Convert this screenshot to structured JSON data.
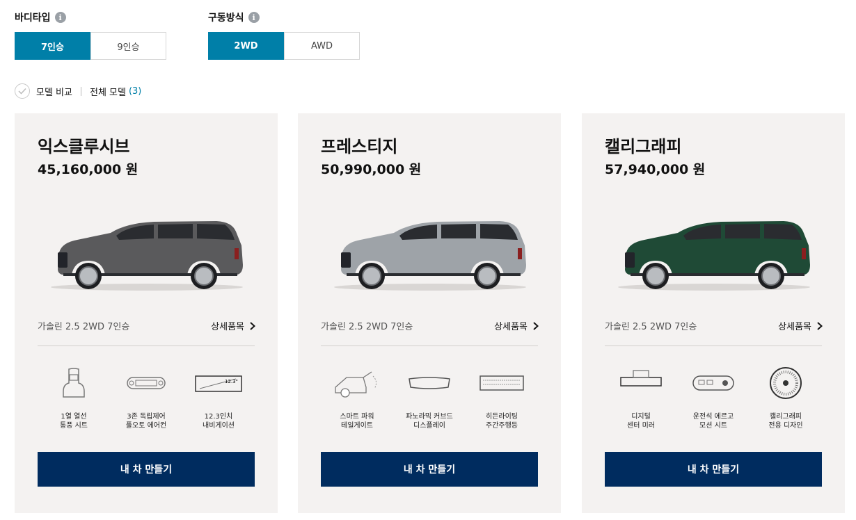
{
  "filters": {
    "body_type": {
      "label": "바디타입",
      "options": [
        "7인승",
        "9인승"
      ],
      "selected": "7인승"
    },
    "drive": {
      "label": "구동방식",
      "options": [
        "2WD",
        "AWD"
      ],
      "selected": "2WD"
    }
  },
  "compare": {
    "label": "모델 비교",
    "all_label": "전체 모델",
    "count": "(3)"
  },
  "cards": [
    {
      "name": "익스클루시브",
      "price": "45,160,000 원",
      "color": "#5a5a5c",
      "spec": "가솔린 2.5 2WD 7인승",
      "detail_label": "상세품목",
      "features": [
        {
          "icon": "heated-seat-icon",
          "line1": "1열 열선",
          "line2": "통풍 시트"
        },
        {
          "icon": "climate-control-icon",
          "line1": "3존 독립제어",
          "line2": "풀오토 에어컨"
        },
        {
          "icon": "navigation-icon",
          "line1": "12.3인치",
          "line2": "내비게이션",
          "badge": "12.3\""
        }
      ],
      "button_label": "내 차 만들기"
    },
    {
      "name": "프레스티지",
      "price": "50,990,000 원",
      "color": "#9ea3a8",
      "spec": "가솔린 2.5 2WD 7인승",
      "detail_label": "상세품목",
      "features": [
        {
          "icon": "power-tailgate-icon",
          "line1": "스마트 파워",
          "line2": "테일게이트"
        },
        {
          "icon": "curved-display-icon",
          "line1": "파노라믹 커브드",
          "line2": "디스플레이"
        },
        {
          "icon": "hidden-lighting-icon",
          "line1": "히든라이팅",
          "line2": "주간주행등"
        }
      ],
      "button_label": "내 차 만들기"
    },
    {
      "name": "캘리그래피",
      "price": "57,940,000 원",
      "color": "#1f4a36",
      "spec": "가솔린 2.5 2WD 7인승",
      "detail_label": "상세품목",
      "features": [
        {
          "icon": "digital-mirror-icon",
          "line1": "디지털",
          "line2": "센터 미러"
        },
        {
          "icon": "ergo-seat-icon",
          "line1": "운전석 에르고",
          "line2": "모션 시트"
        },
        {
          "icon": "calligraphy-wheel-icon",
          "line1": "캘리그래피",
          "line2": "전용 디자인"
        }
      ],
      "button_label": "내 차 만들기"
    }
  ]
}
